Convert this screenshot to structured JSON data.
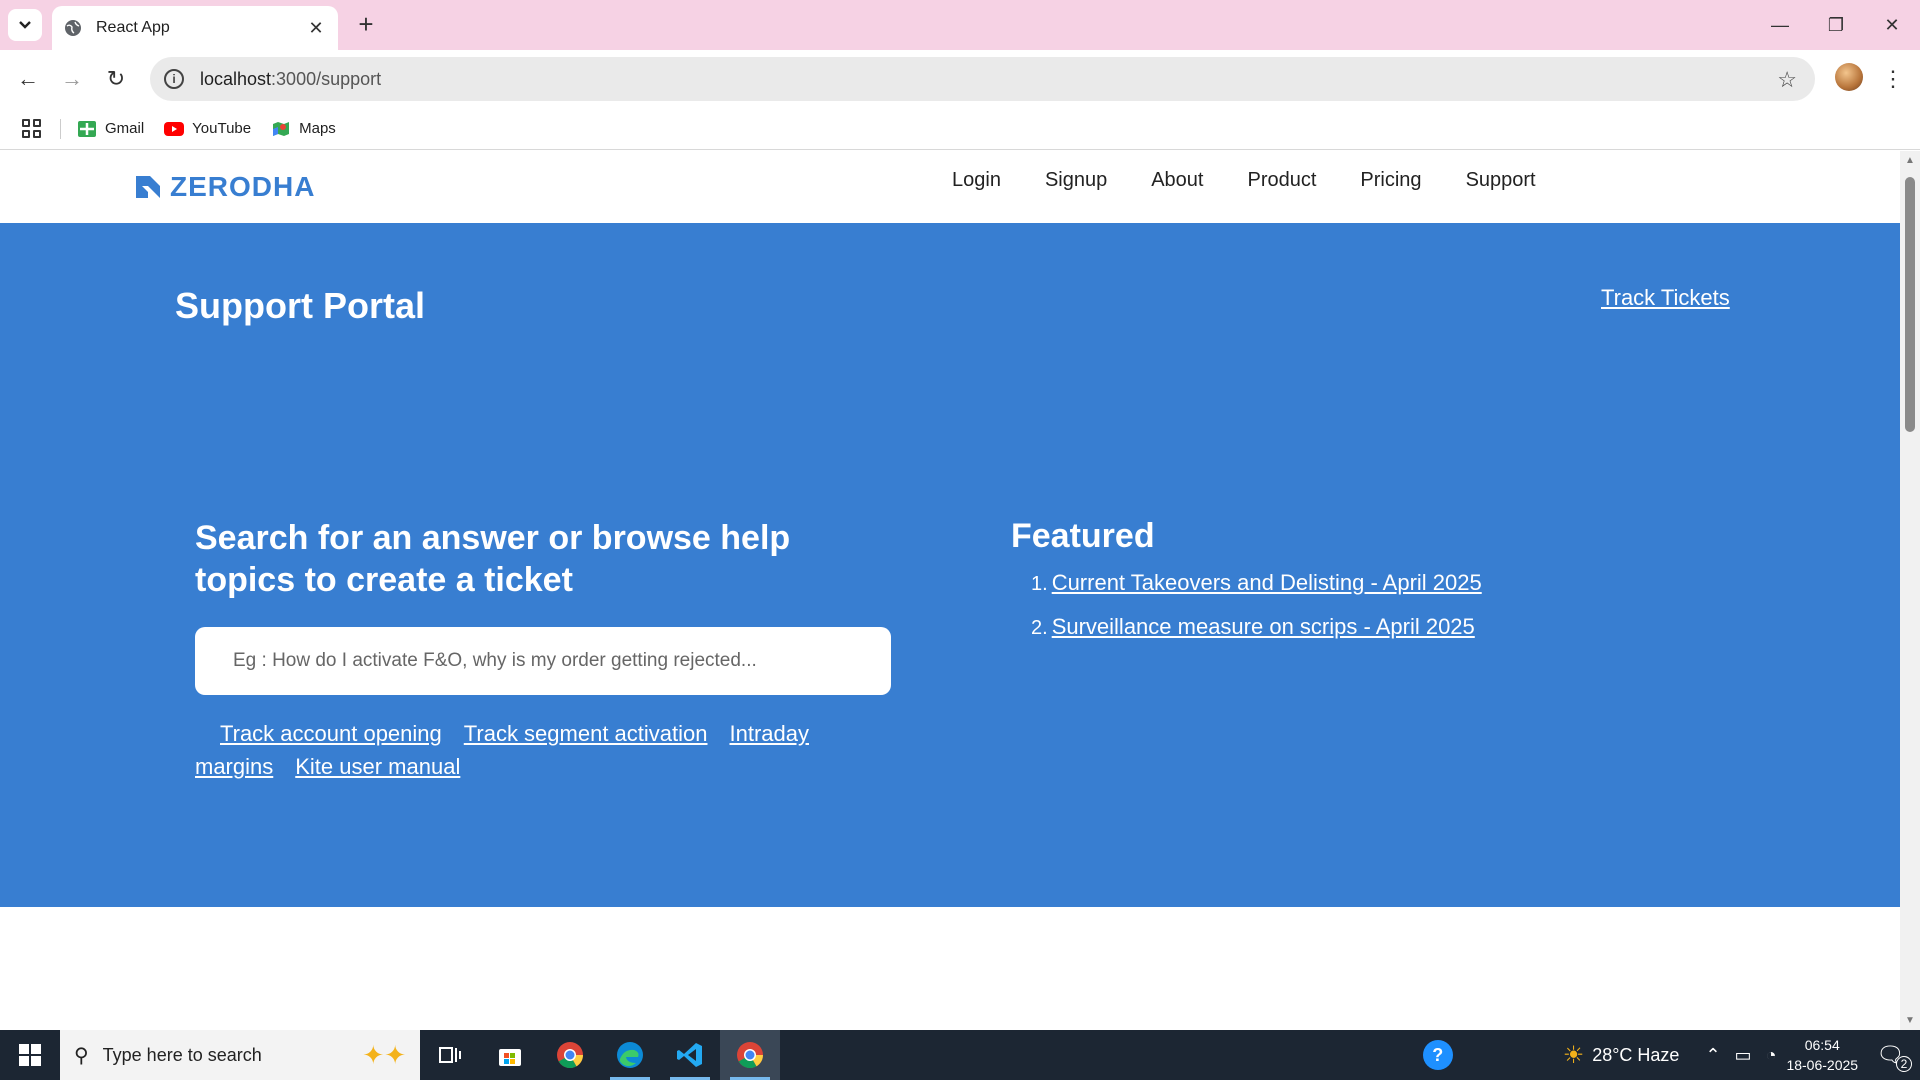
{
  "browser": {
    "tab_title": "React App",
    "url_host": "localhost",
    "url_rest": ":3000/support",
    "bookmarks": [
      {
        "label": "Gmail"
      },
      {
        "label": "YouTube"
      },
      {
        "label": "Maps"
      }
    ]
  },
  "site": {
    "logo_text": "ZERODHA",
    "nav": [
      "Login",
      "Signup",
      "About",
      "Product",
      "Pricing",
      "Support"
    ]
  },
  "hero": {
    "title": "Support Portal",
    "track_tickets": "Track Tickets",
    "search_heading": "Search for an answer or browse help topics to create a ticket",
    "search_placeholder": "Eg : How do I activate F&O, why is my order getting rejected...",
    "quick_links": [
      "Track account opening",
      "Track segment activation",
      "Intraday margins",
      "Kite user manual"
    ],
    "featured_title": "Featured",
    "featured": [
      {
        "num": "1.",
        "label": "Current Takeovers and Delisting - April 2025"
      },
      {
        "num": "2.",
        "label": "Surveillance measure on scrips - April 2025"
      }
    ]
  },
  "taskbar": {
    "search_placeholder": "Type here to search",
    "weather": "28°C  Haze",
    "time": "06:54",
    "date": "18-06-2025",
    "notifications": "2"
  },
  "colors": {
    "brand_blue": "#387ed1",
    "tab_bar": "#f6d2e4",
    "taskbar": "#1c2633"
  }
}
